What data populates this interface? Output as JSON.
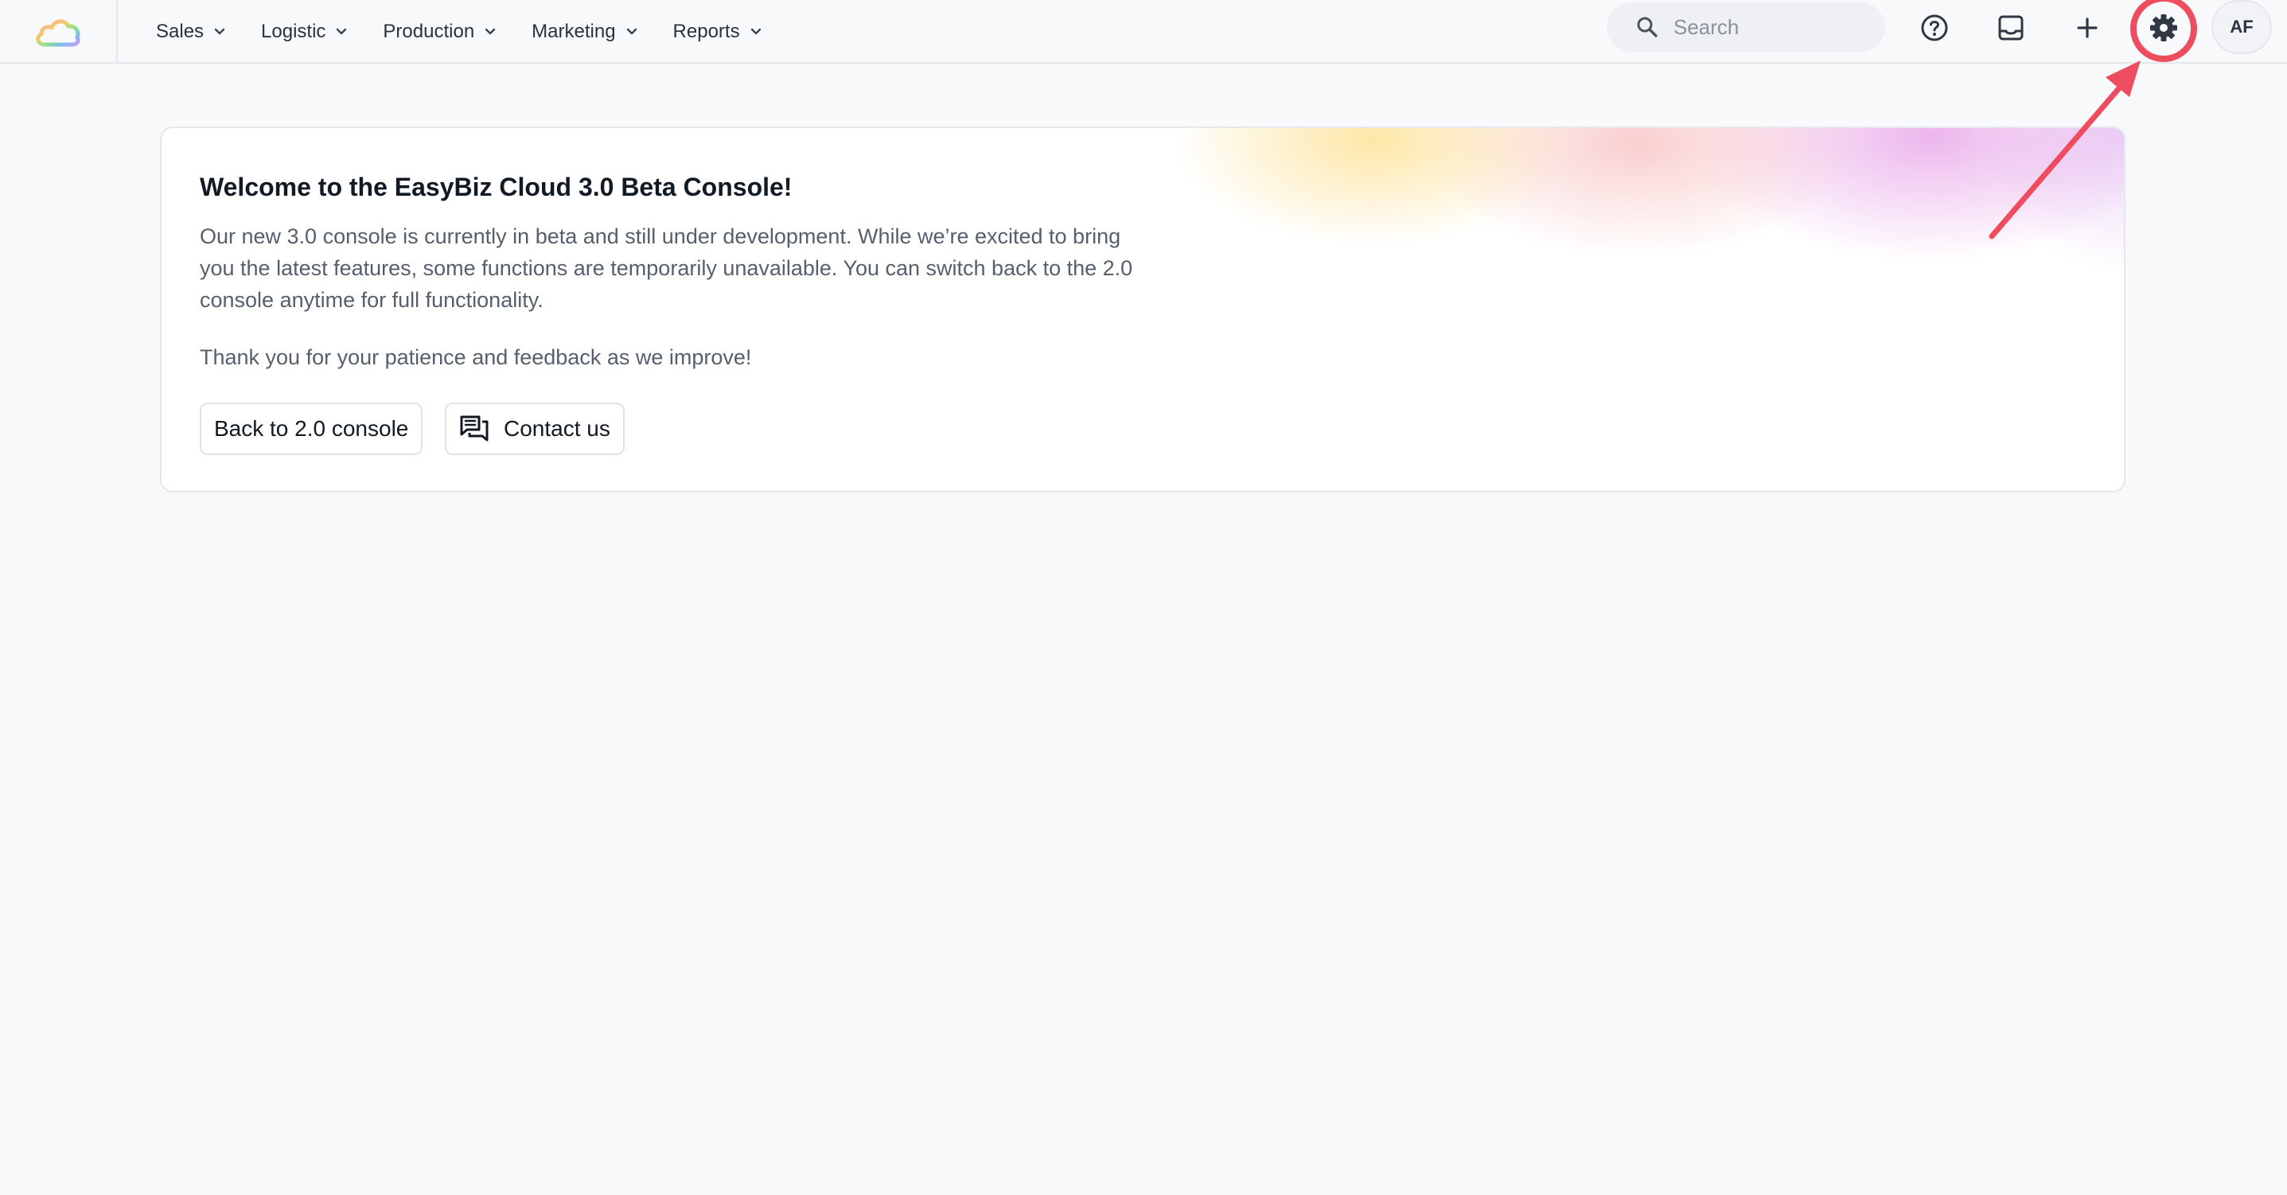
{
  "header": {
    "nav": [
      {
        "label": "Sales"
      },
      {
        "label": "Logistic"
      },
      {
        "label": "Production"
      },
      {
        "label": "Marketing"
      },
      {
        "label": "Reports"
      }
    ],
    "search": {
      "placeholder": "Search"
    },
    "icons": [
      "help-icon",
      "inbox-icon",
      "plus-icon",
      "gear-icon"
    ],
    "avatar": {
      "initials": "AF"
    }
  },
  "welcome": {
    "title": "Welcome to the EasyBiz Cloud 3.0 Beta Console!",
    "paragraph1": "Our new 3.0 console is currently in beta and still under development. While we’re excited to bring you the latest features, some functions are temporarily unavailable. You can switch back to the 2.0 console anytime for full functionality.",
    "paragraph2": "Thank you for your patience and feedback as we improve!",
    "back_button": "Back to 2.0 console",
    "contact_button": "Contact us"
  },
  "colors": {
    "annotation": "#ee4d5f",
    "logo": [
      "#f5a3b5",
      "#f9c96b",
      "#8ee08f",
      "#7fb8f0",
      "#c89cf0"
    ]
  }
}
